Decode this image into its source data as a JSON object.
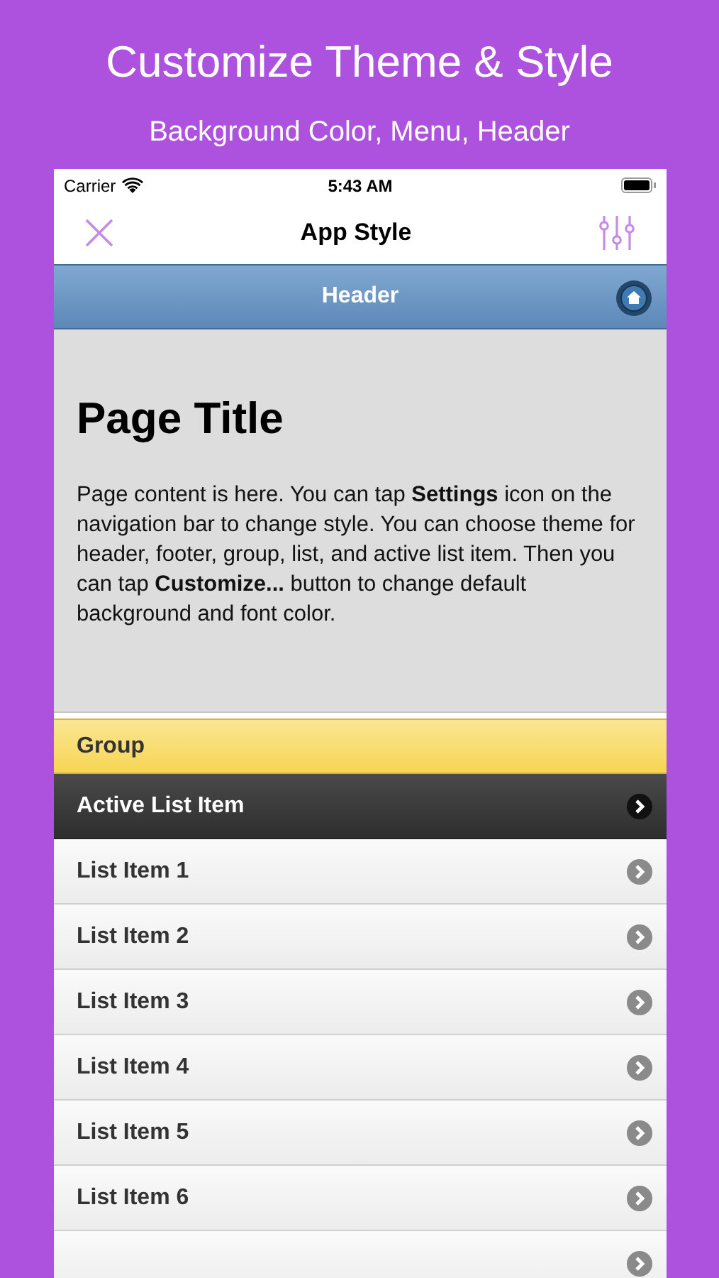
{
  "promo": {
    "title": "Customize Theme & Style",
    "subtitle": "Background Color, Menu, Header"
  },
  "status_bar": {
    "carrier": "Carrier",
    "time": "5:43 AM"
  },
  "nav_bar": {
    "title": "App Style"
  },
  "header": {
    "title": "Header"
  },
  "content": {
    "title": "Page Title",
    "text": "Page content is here. You can tap **Settings** icon on the navigation bar to change style. You can choose theme for header, footer, group, list, and active list item. Then you can tap **Customize...** button to change default background and font color."
  },
  "group": {
    "label": "Group"
  },
  "list": [
    {
      "label": "Active List Item",
      "selected": true
    },
    {
      "label": "List Item 1",
      "selected": false
    },
    {
      "label": "List Item 2",
      "selected": false
    },
    {
      "label": "List Item 3",
      "selected": false
    },
    {
      "label": "List Item 4",
      "selected": false
    },
    {
      "label": "List Item 5",
      "selected": false
    },
    {
      "label": "List Item 6",
      "selected": false
    }
  ]
}
